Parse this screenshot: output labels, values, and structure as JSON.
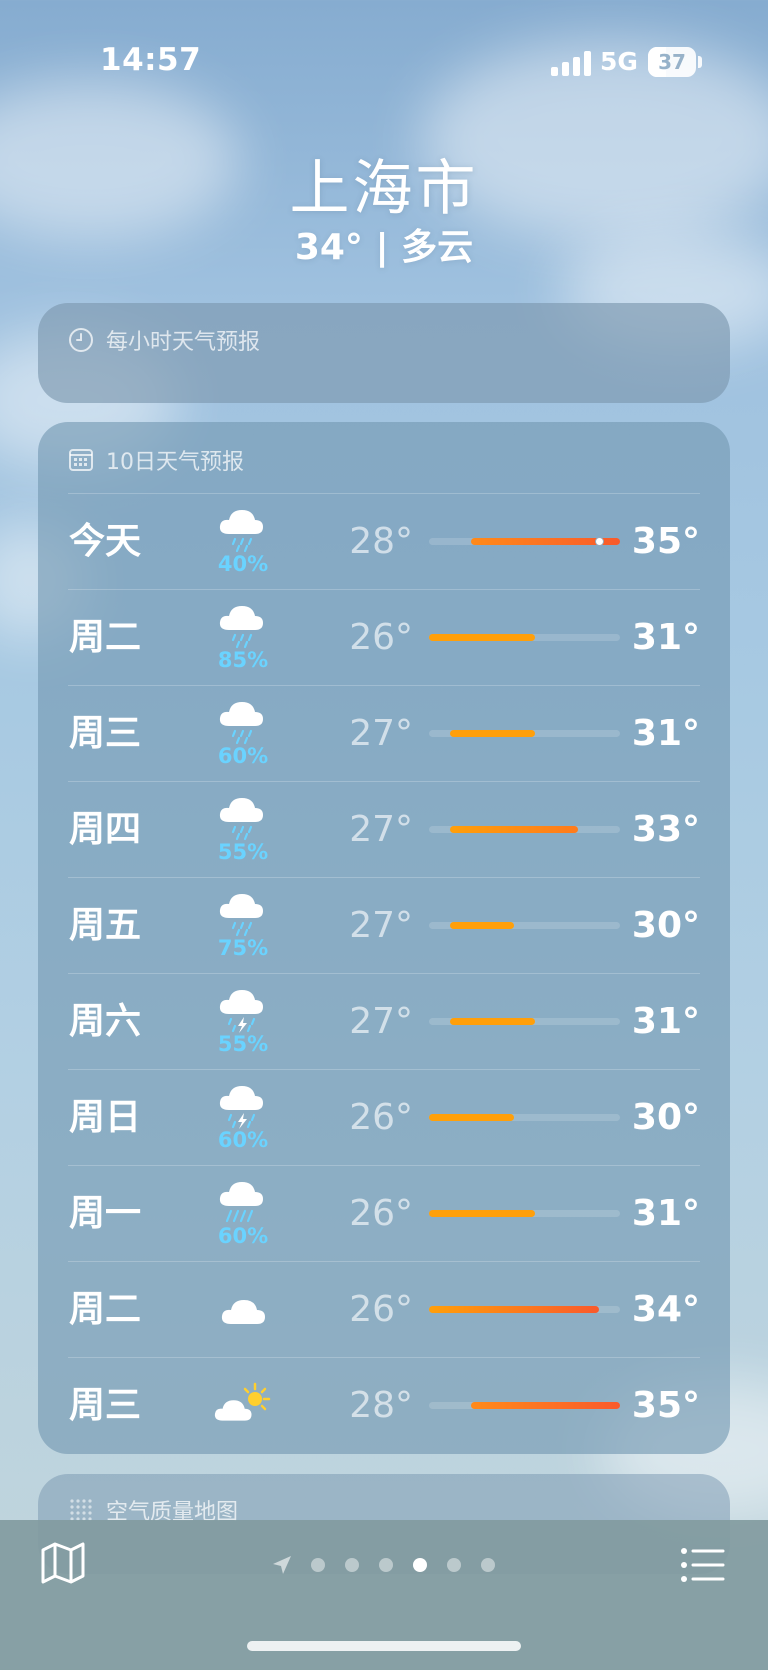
{
  "status": {
    "time": "14:57",
    "network": "5G",
    "battery": "37",
    "battery_level": 0.37
  },
  "location": {
    "city": "上海市",
    "current": "34° | 多云"
  },
  "hourly": {
    "title": "每小时天气预报",
    "icon": "clock-icon"
  },
  "daily": {
    "title": "10日天气预报",
    "icon": "calendar-icon",
    "range_min": 26,
    "range_max": 35,
    "days": [
      {
        "day": "今天",
        "icon": "cloud-rain",
        "precip": "40%",
        "low": "28°",
        "high": "35°",
        "lo_val": 28,
        "hi_val": 35,
        "current_val": 34,
        "colors": [
          "#ff8a1a",
          "#f95a2c"
        ]
      },
      {
        "day": "周二",
        "icon": "cloud-rain",
        "precip": "85%",
        "low": "26°",
        "high": "31°",
        "lo_val": 26,
        "hi_val": 31,
        "colors": [
          "#ff9f0a",
          "#ff9f0a"
        ]
      },
      {
        "day": "周三",
        "icon": "cloud-rain",
        "precip": "60%",
        "low": "27°",
        "high": "31°",
        "lo_val": 27,
        "hi_val": 31,
        "colors": [
          "#ff9f0a",
          "#ff9f0a"
        ]
      },
      {
        "day": "周四",
        "icon": "cloud-rain",
        "precip": "55%",
        "low": "27°",
        "high": "33°",
        "lo_val": 27,
        "hi_val": 33,
        "colors": [
          "#ff9f0a",
          "#ff7b1c"
        ]
      },
      {
        "day": "周五",
        "icon": "cloud-rain",
        "precip": "75%",
        "low": "27°",
        "high": "30°",
        "lo_val": 27,
        "hi_val": 30,
        "colors": [
          "#ff9f0a",
          "#ff9f0a"
        ]
      },
      {
        "day": "周六",
        "icon": "cloud-bolt-rain",
        "precip": "55%",
        "low": "27°",
        "high": "31°",
        "lo_val": 27,
        "hi_val": 31,
        "colors": [
          "#ff9f0a",
          "#ff9f0a"
        ]
      },
      {
        "day": "周日",
        "icon": "cloud-bolt-rain",
        "precip": "60%",
        "low": "26°",
        "high": "30°",
        "lo_val": 26,
        "hi_val": 30,
        "colors": [
          "#ffa00a",
          "#ff9f0a"
        ]
      },
      {
        "day": "周一",
        "icon": "cloud-heavy-rain",
        "precip": "60%",
        "low": "26°",
        "high": "31°",
        "lo_val": 26,
        "hi_val": 31,
        "colors": [
          "#ffa00a",
          "#ff9f0a"
        ]
      },
      {
        "day": "周二",
        "icon": "cloud",
        "precip": "",
        "low": "26°",
        "high": "34°",
        "lo_val": 26,
        "hi_val": 34,
        "colors": [
          "#ff9f0a",
          "#f95a2c"
        ]
      },
      {
        "day": "周三",
        "icon": "cloud-sun",
        "precip": "",
        "low": "28°",
        "high": "35°",
        "lo_val": 28,
        "hi_val": 35,
        "colors": [
          "#ff8a1a",
          "#f95a2c"
        ]
      }
    ]
  },
  "air_quality": {
    "title": "空气质量地图",
    "icon": "grid-icon"
  },
  "bottom": {
    "map_icon": "map-icon",
    "list_icon": "list-icon",
    "location_icon": "location-arrow-icon",
    "page_count": 6,
    "active_page": 4
  }
}
